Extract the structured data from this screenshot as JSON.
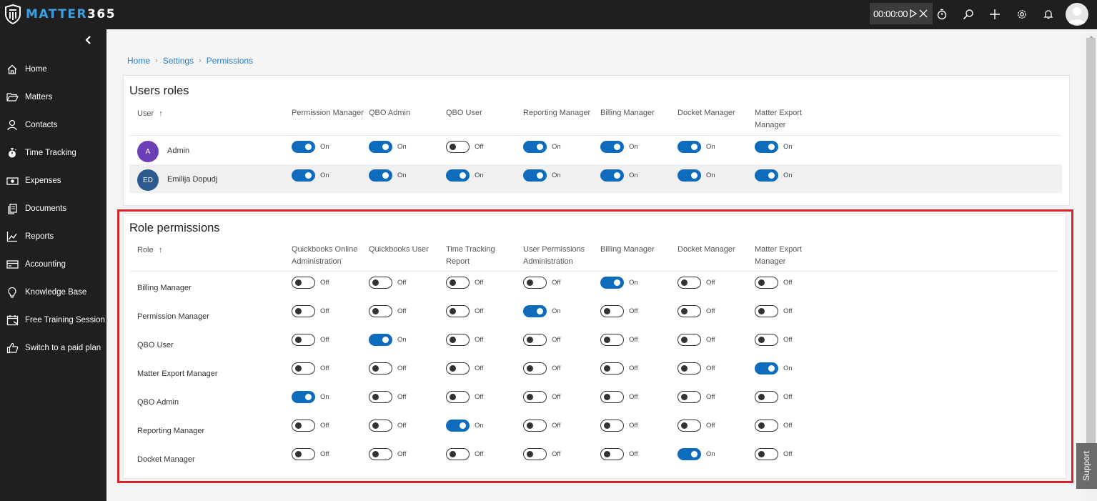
{
  "app": {
    "logo_text_a": "MATTER",
    "logo_text_b": "365"
  },
  "topbar": {
    "timer": "00:00:00",
    "icons": [
      "play-icon",
      "close-icon",
      "stopwatch-icon",
      "search-icon",
      "plus-icon",
      "gear-icon",
      "bell-icon",
      "user-avatar"
    ]
  },
  "sidebar": {
    "items": [
      {
        "label": "Home",
        "icon": "home-icon"
      },
      {
        "label": "Matters",
        "icon": "folder-icon"
      },
      {
        "label": "Contacts",
        "icon": "person-icon"
      },
      {
        "label": "Time Tracking",
        "icon": "stopwatch-icon"
      },
      {
        "label": "Expenses",
        "icon": "money-icon"
      },
      {
        "label": "Documents",
        "icon": "documents-icon"
      },
      {
        "label": "Reports",
        "icon": "chart-icon"
      },
      {
        "label": "Accounting",
        "icon": "card-icon"
      },
      {
        "label": "Knowledge Base",
        "icon": "lightbulb-icon"
      },
      {
        "label": "Free Training Session",
        "icon": "calendar-icon"
      },
      {
        "label": "Switch to a paid plan",
        "icon": "thumbs-up-icon"
      }
    ]
  },
  "breadcrumb": {
    "home": "Home",
    "settings": "Settings",
    "current": "Permissions"
  },
  "support_label": "Support",
  "colors": {
    "accent": "#0f6cbd",
    "highlight": "#d9262c",
    "sidebar": "#1f1f1f"
  },
  "users_roles": {
    "title": "Users roles",
    "user_header": "User",
    "columns": [
      [
        "Permission Manager"
      ],
      [
        "QBO Admin"
      ],
      [
        "QBO User"
      ],
      [
        "Reporting Manager"
      ],
      [
        "Billing Manager"
      ],
      [
        "Docket Manager"
      ],
      [
        "Matter Export",
        "Manager"
      ]
    ],
    "rows": [
      {
        "initials": "A",
        "name": "Admin",
        "avatar_color": "#6b3fb5",
        "values": [
          "On",
          "On",
          "Off",
          "On",
          "On",
          "On",
          "On"
        ]
      },
      {
        "initials": "ED",
        "name": "Emilija Dopudj",
        "avatar_color": "#2c5a8f",
        "values": [
          "On",
          "On",
          "On",
          "On",
          "On",
          "On",
          "On"
        ]
      }
    ]
  },
  "role_permissions": {
    "title": "Role permissions",
    "role_header": "Role",
    "columns": [
      [
        "Quickbooks Online",
        "Administration"
      ],
      [
        "Quickbooks User"
      ],
      [
        "Time Tracking",
        "Report"
      ],
      [
        "User Permissions",
        "Administration"
      ],
      [
        "Billing Manager"
      ],
      [
        "Docket Manager"
      ],
      [
        "Matter Export",
        "Manager"
      ]
    ],
    "rows": [
      {
        "name": "Billing Manager",
        "values": [
          "Off",
          "Off",
          "Off",
          "Off",
          "On",
          "Off",
          "Off"
        ]
      },
      {
        "name": "Permission Manager",
        "values": [
          "Off",
          "Off",
          "Off",
          "On",
          "Off",
          "Off",
          "Off"
        ]
      },
      {
        "name": "QBO User",
        "values": [
          "Off",
          "On",
          "Off",
          "Off",
          "Off",
          "Off",
          "Off"
        ]
      },
      {
        "name": "Matter Export Manager",
        "values": [
          "Off",
          "Off",
          "Off",
          "Off",
          "Off",
          "Off",
          "On"
        ]
      },
      {
        "name": "QBO Admin",
        "values": [
          "On",
          "Off",
          "Off",
          "Off",
          "Off",
          "Off",
          "Off"
        ]
      },
      {
        "name": "Reporting Manager",
        "values": [
          "Off",
          "Off",
          "On",
          "Off",
          "Off",
          "Off",
          "Off"
        ]
      },
      {
        "name": "Docket Manager",
        "values": [
          "Off",
          "Off",
          "Off",
          "Off",
          "Off",
          "On",
          "Off"
        ]
      }
    ]
  }
}
